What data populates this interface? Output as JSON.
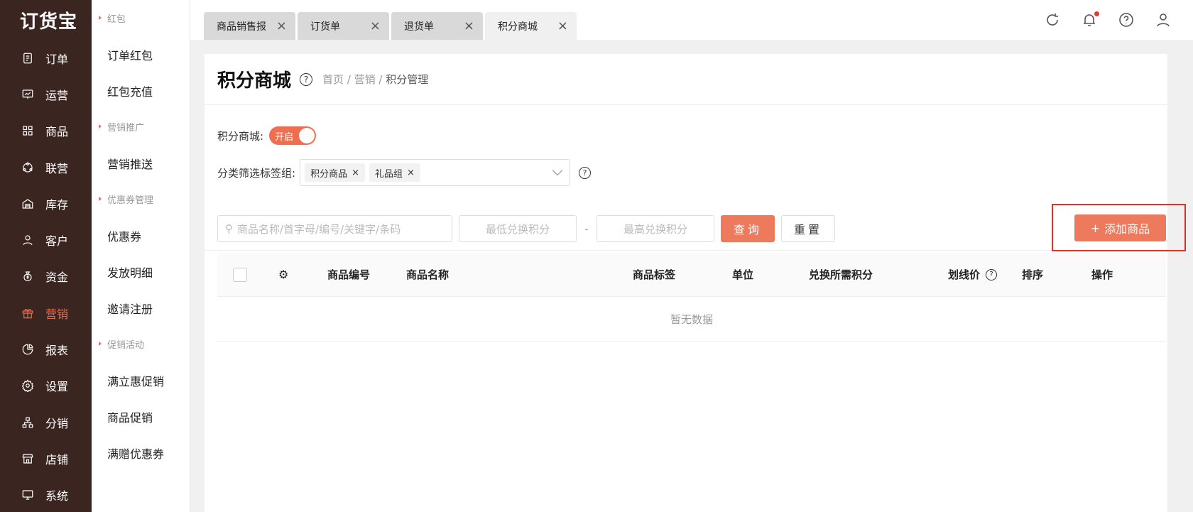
{
  "app": {
    "logo": "订货宝"
  },
  "sidebar": {
    "items": [
      {
        "label": "订单",
        "icon": "order-icon"
      },
      {
        "label": "运营",
        "icon": "chart-icon"
      },
      {
        "label": "商品",
        "icon": "grid-icon"
      },
      {
        "label": "联营",
        "icon": "share-icon"
      },
      {
        "label": "库存",
        "icon": "warehouse-icon"
      },
      {
        "label": "客户",
        "icon": "user-icon"
      },
      {
        "label": "资金",
        "icon": "money-bag-icon"
      },
      {
        "label": "营销",
        "icon": "gift-icon",
        "active": true
      },
      {
        "label": "报表",
        "icon": "pie-icon"
      },
      {
        "label": "设置",
        "icon": "gear-icon"
      },
      {
        "label": "分销",
        "icon": "tree-icon"
      },
      {
        "label": "店铺",
        "icon": "store-icon"
      },
      {
        "label": "系统",
        "icon": "monitor-icon"
      }
    ]
  },
  "submenu": [
    {
      "group": "红包"
    },
    {
      "item": "订单红包"
    },
    {
      "item": "红包充值"
    },
    {
      "group": "营销推广"
    },
    {
      "item": "营销推送"
    },
    {
      "group": "优惠券管理"
    },
    {
      "item": "优惠券"
    },
    {
      "item": "发放明细"
    },
    {
      "item": "邀请注册"
    },
    {
      "group": "促销活动"
    },
    {
      "item": "满立惠促销"
    },
    {
      "item": "商品促销"
    },
    {
      "item": "满赠优惠券"
    }
  ],
  "tabs": [
    {
      "label": "商品销售报"
    },
    {
      "label": "订货单"
    },
    {
      "label": "退货单"
    },
    {
      "label": "积分商城",
      "active": true
    }
  ],
  "page": {
    "title": "积分商城",
    "breadcrumb": [
      "首页",
      "营销",
      "积分管理"
    ]
  },
  "filters": {
    "mall_label": "积分商城:",
    "switch_text": "开启",
    "tag_label": "分类筛选标签组:",
    "tags": [
      "积分商品",
      "礼品组"
    ]
  },
  "search": {
    "placeholder": "商品名称/首字母/编号/关键字/条码",
    "min_placeholder": "最低兑换积分",
    "max_placeholder": "最高兑换积分",
    "dash": "-",
    "query": "查询",
    "reset": "重置",
    "add": "添加商品"
  },
  "table": {
    "columns": [
      "商品编号",
      "商品名称",
      "商品标签",
      "单位",
      "兑换所需积分",
      "划线价",
      "排序",
      "操作"
    ],
    "empty": "暂无数据"
  },
  "colors": {
    "accent": "#ee6e4f",
    "sidebar": "#3a2520",
    "highlight_box": "#e0302a"
  }
}
